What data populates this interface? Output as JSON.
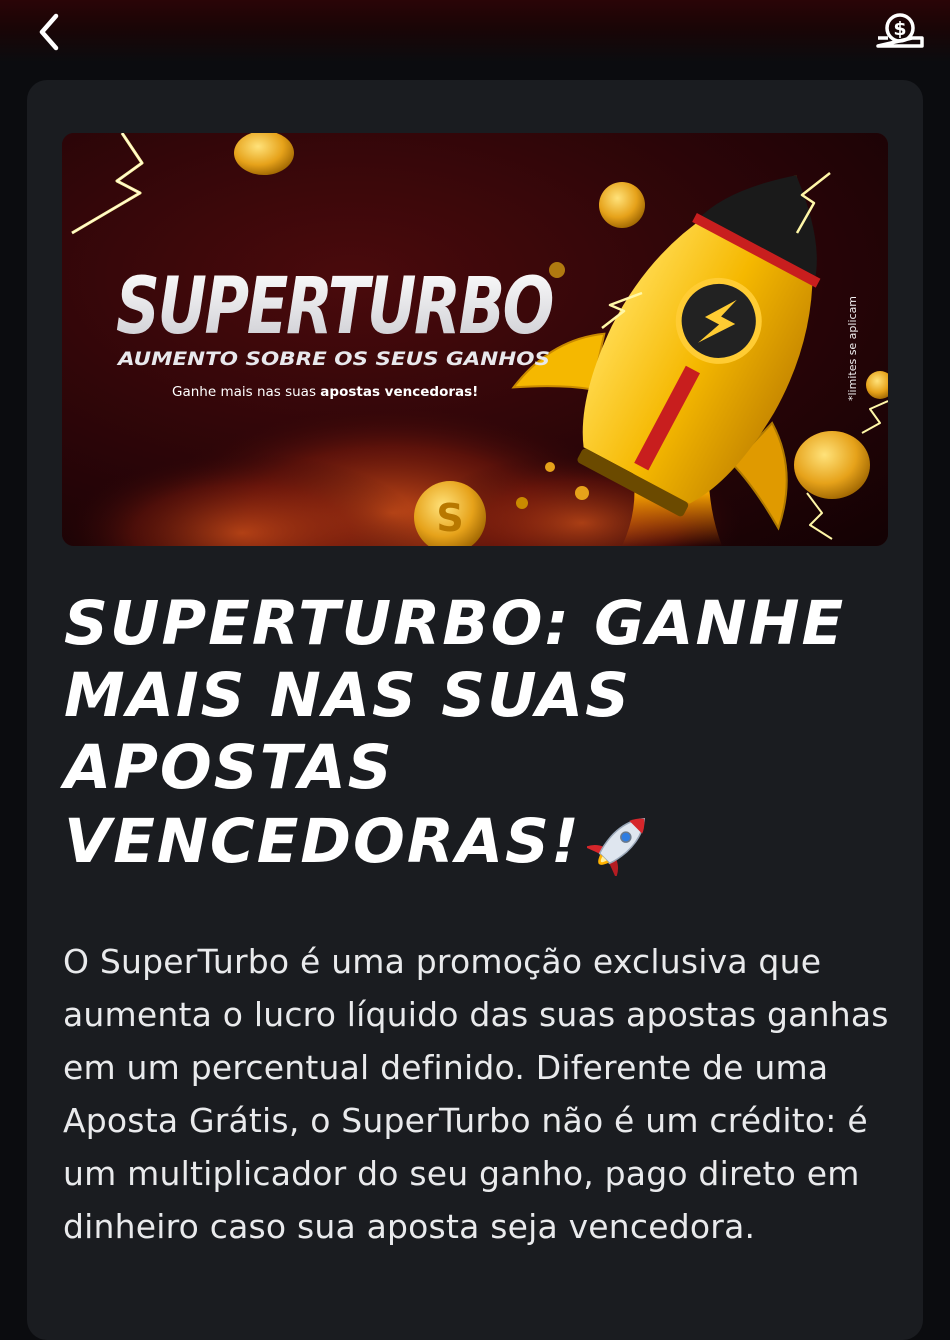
{
  "header": {
    "back_icon": "chevron-left-icon",
    "wallet_icon": "money-wallet-icon"
  },
  "banner": {
    "brand": "SUPERTURBO",
    "subtitle": "AUMENTO SOBRE OS SEUS GANHOS",
    "tagline_prefix": "Ganhe mais nas suas ",
    "tagline_bold": "apostas vencedoras!",
    "disclaimer": "*limites se aplicam",
    "illustration": "rocket-with-coins",
    "colors": {
      "background": "#2a0608",
      "rocket": "#f5b800",
      "coin": "#e6a21a",
      "lightning": "#fff7a8"
    }
  },
  "article": {
    "title": "SUPERTURBO: GANHE MAIS NAS SUAS APOSTAS VENCEDORAS!",
    "title_emoji": "rocket-icon",
    "body": "O SuperTurbo é uma promoção exclusiva que aumenta o lucro líquido das suas apostas ganhas em um percentual definido. Diferente de uma Aposta Grátis, o SuperTurbo não é um crédito: é um multiplicador do seu ganho, pago direto em dinheiro caso sua aposta seja vencedora."
  }
}
